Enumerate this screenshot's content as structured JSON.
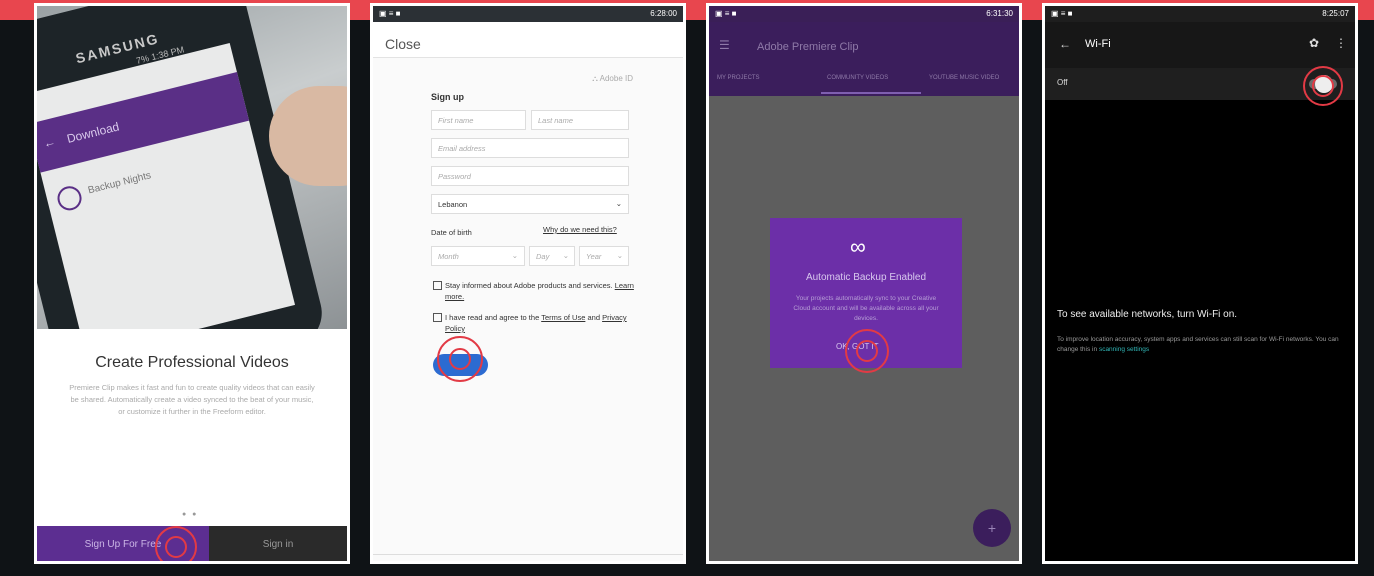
{
  "panel1": {
    "phone_brand": "SAMSUNG",
    "phone_status": "7% 1:38 PM",
    "app_bar": "Download",
    "list_item": "Backup Nights",
    "title": "Create Professional Videos",
    "description": "Premiere Clip makes it fast and fun to create quality videos that can easily be shared. Automatically create a video synced to the beat of your music, or customize it further in the Freeform editor.",
    "dots": "● ●",
    "signup_label": "Sign Up For Free",
    "signin_label": "Sign in"
  },
  "panel2": {
    "status_time": "6:28:00",
    "close_label": "Close",
    "adobe_id": "Adobe ID",
    "signup_heading": "Sign up",
    "first_name_placeholder": "First name",
    "last_name_placeholder": "Last name",
    "email_placeholder": "Email address",
    "password_placeholder": "Password",
    "country_value": "Lebanon",
    "dob_label": "Date of birth",
    "why_link": "Why do we need this?",
    "month_placeholder": "Month",
    "day_placeholder": "Day",
    "year_placeholder": "Year",
    "stay_informed": "Stay informed about Adobe products and services.",
    "learn_more": "Learn more.",
    "terms_text": "I have read and agree to the",
    "terms_link": "Terms of Use",
    "and": "and",
    "privacy_link": "Privacy Policy"
  },
  "panel3": {
    "status_time": "6:31:30",
    "menu_icon": "☰",
    "app_title": "Adobe Premiere Clip",
    "tabs": [
      "MY PROJECTS",
      "COMMUNITY VIDEOS",
      "YOUTUBE MUSIC VIDEO"
    ],
    "dialog_title": "Automatic Backup Enabled",
    "dialog_text": "Your projects automatically sync to your Creative Cloud account and will be available across all your devices.",
    "ok_label": "OK, GOT IT",
    "fab_label": "+"
  },
  "panel4": {
    "status_time": "8:25:07",
    "title": "Wi-Fi",
    "off_label": "Off",
    "message": "To see available networks, turn Wi-Fi on.",
    "submessage": "To improve location accuracy, system apps and services can still scan for Wi-Fi networks. You can change this in",
    "scanning_link": "scanning settings",
    "toggle_on": false
  },
  "colors": {
    "frame_bg": "#0f1316",
    "top_bar": "#e8464e",
    "highlight_ring": "#e23a45",
    "adobe_purple": "#5c2e91"
  }
}
